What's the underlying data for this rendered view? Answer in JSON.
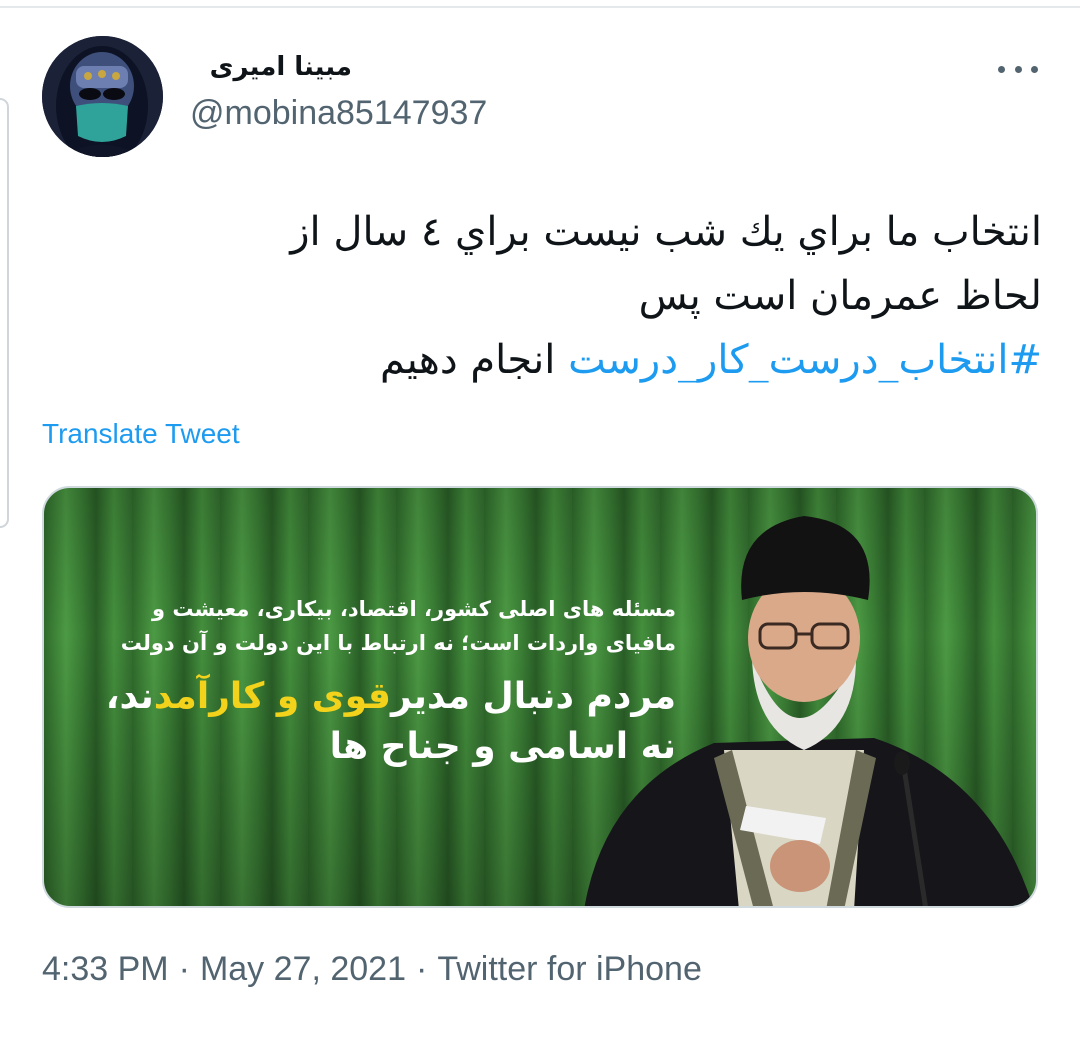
{
  "author": {
    "display_name": "مبینا امیری",
    "handle": "@mobina85147937",
    "avatar_icon": "user-avatar-photo"
  },
  "more_icon": "ellipsis-icon",
  "tweet": {
    "line1": "انتخاب ما براي يك شب نيست براي ٤ سال از",
    "line2": "لحاظ عمرمان است پس",
    "hashtag": "#انتخاب_درست_كار_درست",
    "line3_rest": "انجام دهيم"
  },
  "translate_label": "Translate Tweet",
  "media": {
    "caption_line1": "مسئله های اصلی کشور، اقتصاد، بیکاری، معیشت و",
    "caption_line2": "مافیای واردات است؛ نه ارتباط با این دولت و آن دولت",
    "headline_part1": "مردم دنبال مدیر",
    "headline_highlight": "قوی و کارآمد",
    "headline_part2": "ند،",
    "headline_line2": "نه اسامی و جناح ها"
  },
  "meta": {
    "time": "4:33 PM",
    "date": "May 27, 2021",
    "source": "Twitter for iPhone",
    "separator": "·"
  },
  "colors": {
    "link": "#1d9bf0",
    "muted": "#536471",
    "text": "#0f1419",
    "highlight": "#f2d21b"
  }
}
